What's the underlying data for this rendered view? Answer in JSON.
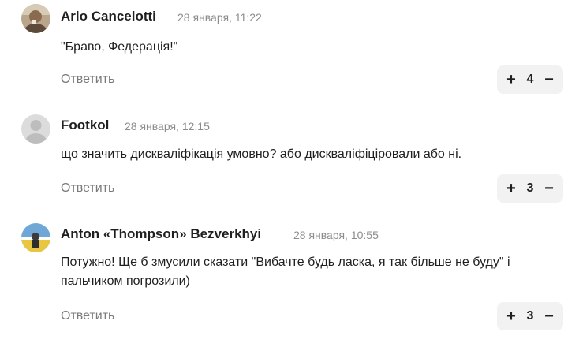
{
  "comments": [
    {
      "author": "Arlo Cancelotti",
      "timestamp": "28 января, 11:22",
      "text": "\"Браво, Федерація!\"",
      "reply_label": "Ответить",
      "score": "4",
      "avatar_icon": "user-photo-avatar"
    },
    {
      "author": "Footkol",
      "timestamp": "28 января, 12:15",
      "text": "що значить дискваліфікація умовно? або дискваліфіціровали або ні.",
      "reply_label": "Ответить",
      "score": "3",
      "avatar_icon": "default-user-avatar"
    },
    {
      "author": "Anton «Thompson» Bezverkhyi",
      "timestamp": "28 января, 10:55",
      "text": "Потужно! Ще б змусили сказати \"Вибачте будь ласка, я так більше не буду\" і пальчиком погрозили)",
      "reply_label": "Ответить",
      "score": "3",
      "avatar_icon": "user-photo-avatar"
    }
  ],
  "vote": {
    "plus": "+",
    "minus": "−"
  },
  "colors": {
    "vote_bg": "#f2f2f2",
    "muted": "#8c8c8c",
    "reply": "#7a7a7a"
  }
}
